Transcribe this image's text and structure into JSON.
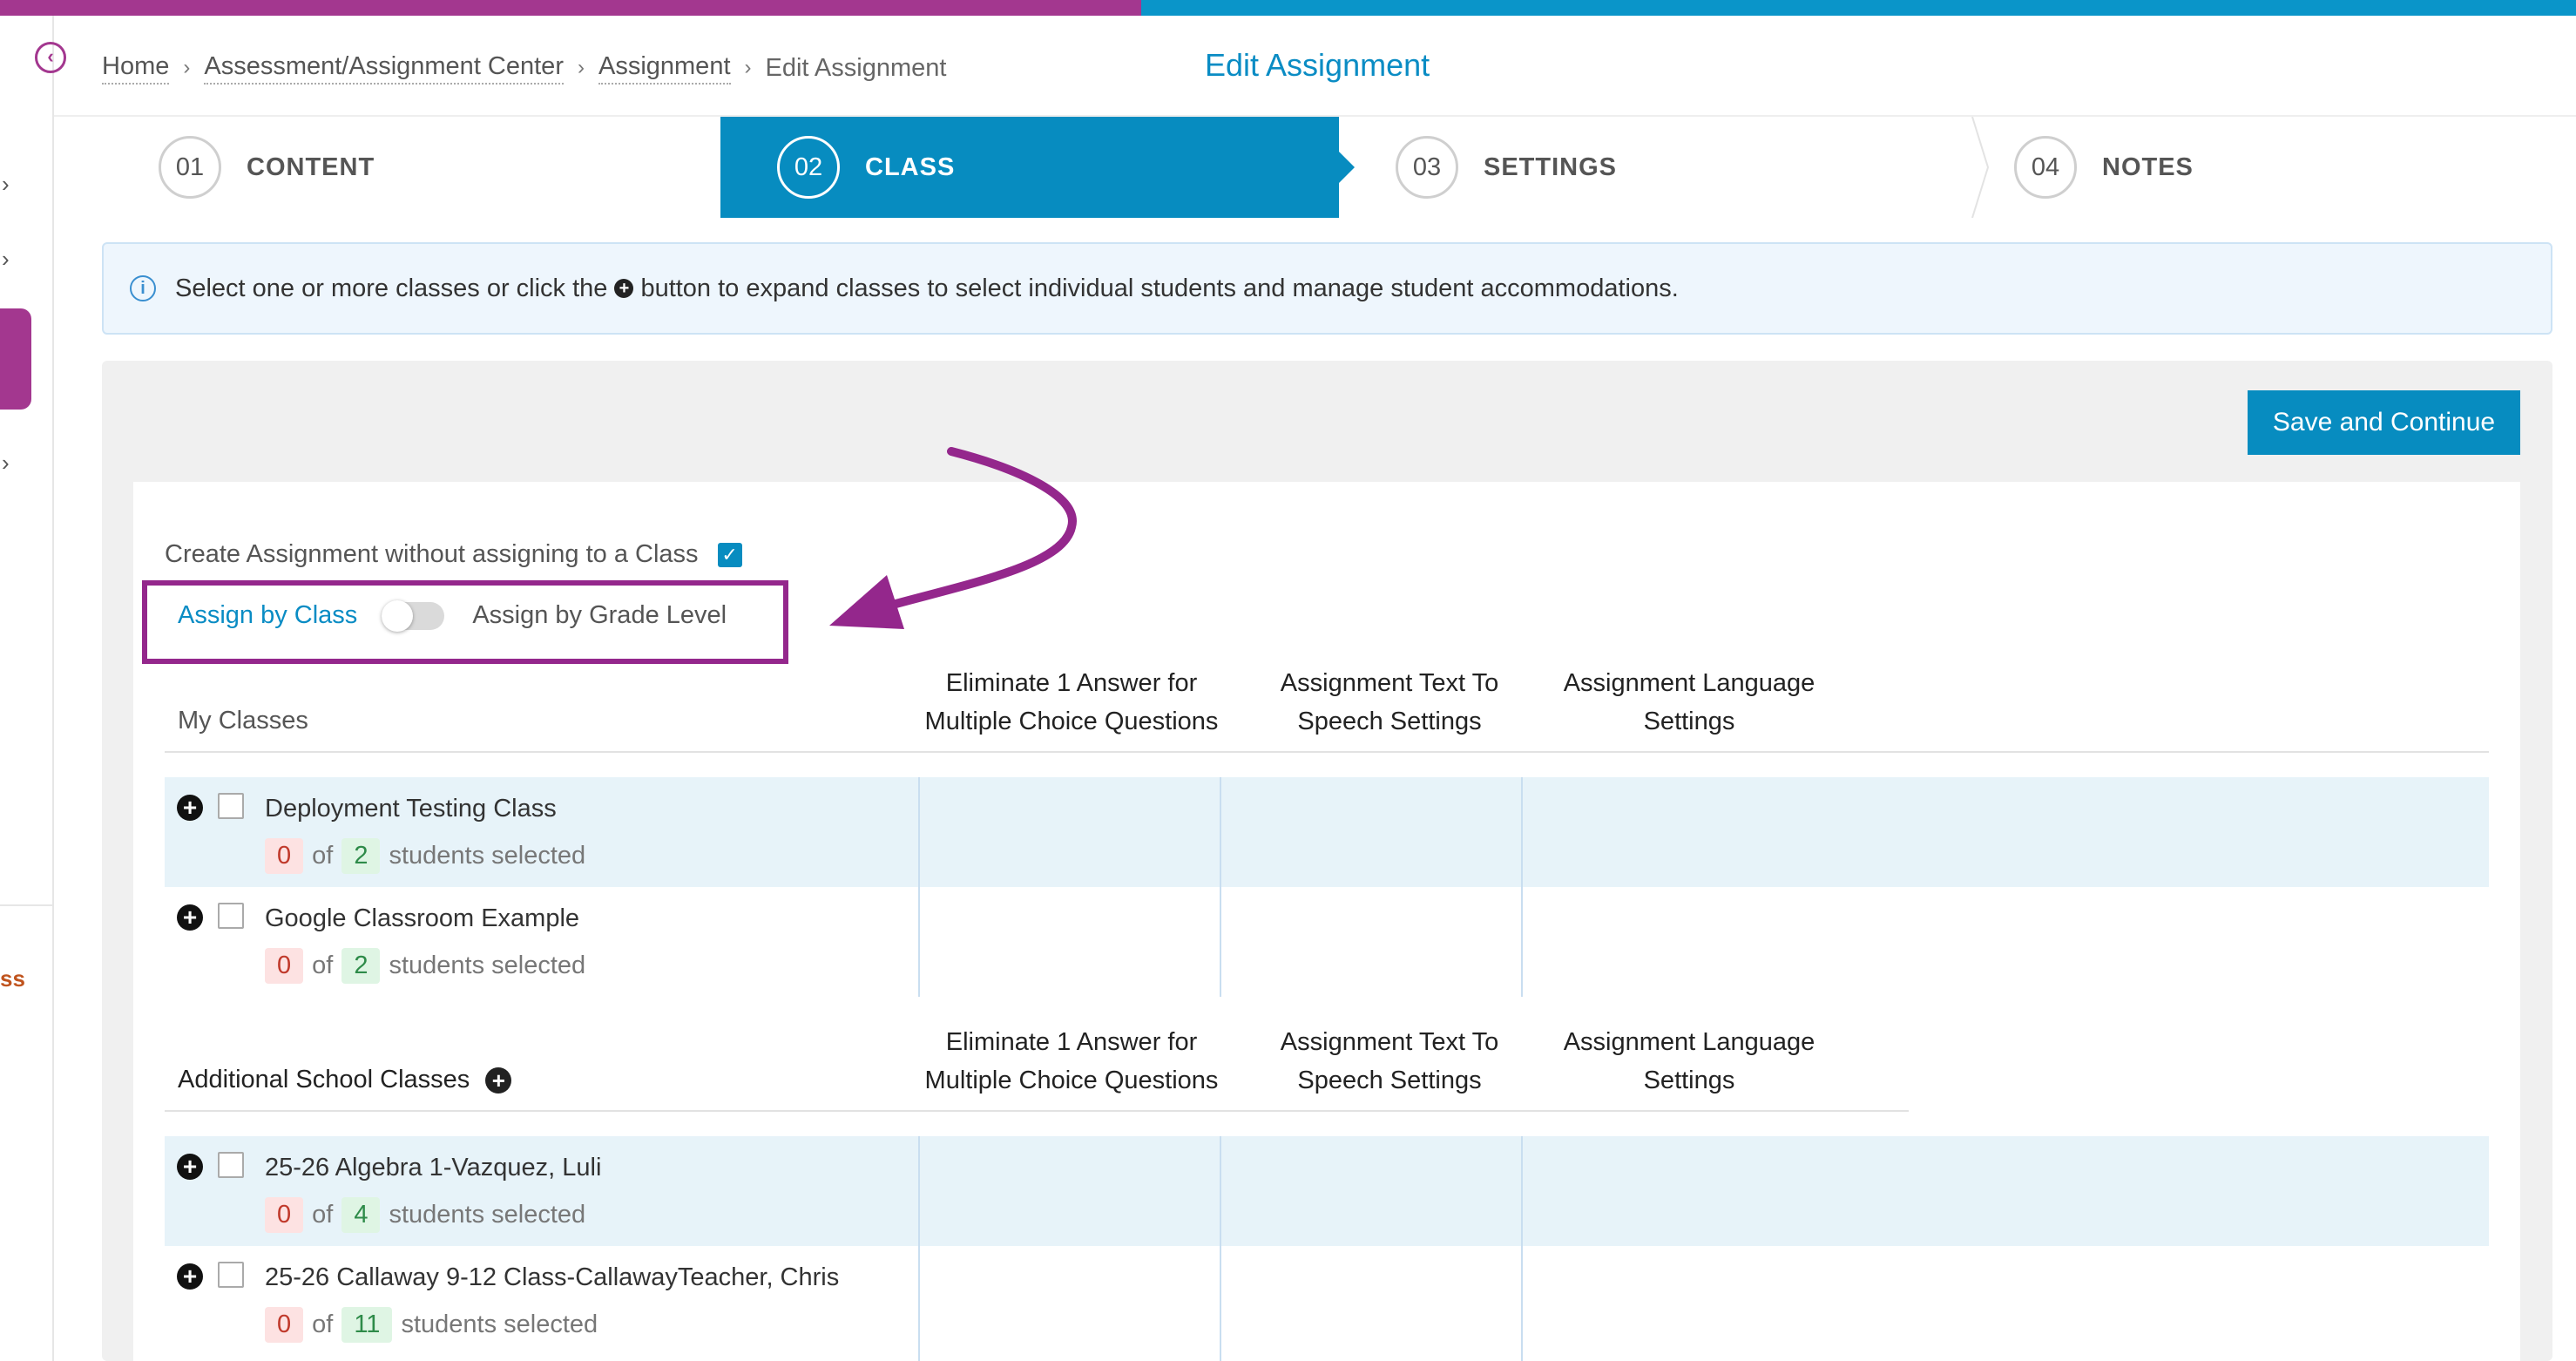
{
  "breadcrumb": {
    "items": [
      "Home",
      "Assessment/Assignment Center",
      "Assignment"
    ],
    "current": "Edit Assignment"
  },
  "page_title": "Edit Assignment",
  "steps": [
    {
      "num": "01",
      "label": "CONTENT",
      "active": false
    },
    {
      "num": "02",
      "label": "CLASS",
      "active": true
    },
    {
      "num": "03",
      "label": "SETTINGS",
      "active": false
    },
    {
      "num": "04",
      "label": "NOTES",
      "active": false
    }
  ],
  "info": {
    "before": "Select one or more classes or click the",
    "after": "button to expand classes to select individual students and manage student accommodations."
  },
  "save_label": "Save and Continue",
  "no_class": {
    "label": "Create Assignment without assigning to a Class",
    "checked": true
  },
  "toggle": {
    "left_label": "Assign by Class",
    "right_label": "Assign by Grade Level"
  },
  "columns": {
    "eliminate": [
      "Eliminate 1 Answer for",
      "Multiple Choice Questions"
    ],
    "tts": [
      "Assignment Text To",
      "Speech Settings"
    ],
    "language": [
      "Assignment Language",
      "Settings"
    ]
  },
  "my_classes": {
    "title": "My Classes",
    "rows": [
      {
        "name": "Deployment Testing Class",
        "selected": "0",
        "of": "of",
        "total": "2",
        "suffix": "students selected"
      },
      {
        "name": "Google Classroom Example",
        "selected": "0",
        "of": "of",
        "total": "2",
        "suffix": "students selected"
      }
    ]
  },
  "additional": {
    "title": "Additional School Classes",
    "rows": [
      {
        "name": "25-26 Algebra 1-Vazquez, Luli",
        "selected": "0",
        "of": "of",
        "total": "4",
        "suffix": "students selected"
      },
      {
        "name": "25-26 Callaway 9-12 Class-CallawayTeacher, Chris",
        "selected": "0",
        "of": "of",
        "total": "11",
        "suffix": "students selected"
      }
    ]
  },
  "sidebar": {
    "partial_label": "ss"
  },
  "colors": {
    "accent_blue": "#078cc0",
    "brand_purple": "#a3378f",
    "annotation": "#94278c"
  }
}
